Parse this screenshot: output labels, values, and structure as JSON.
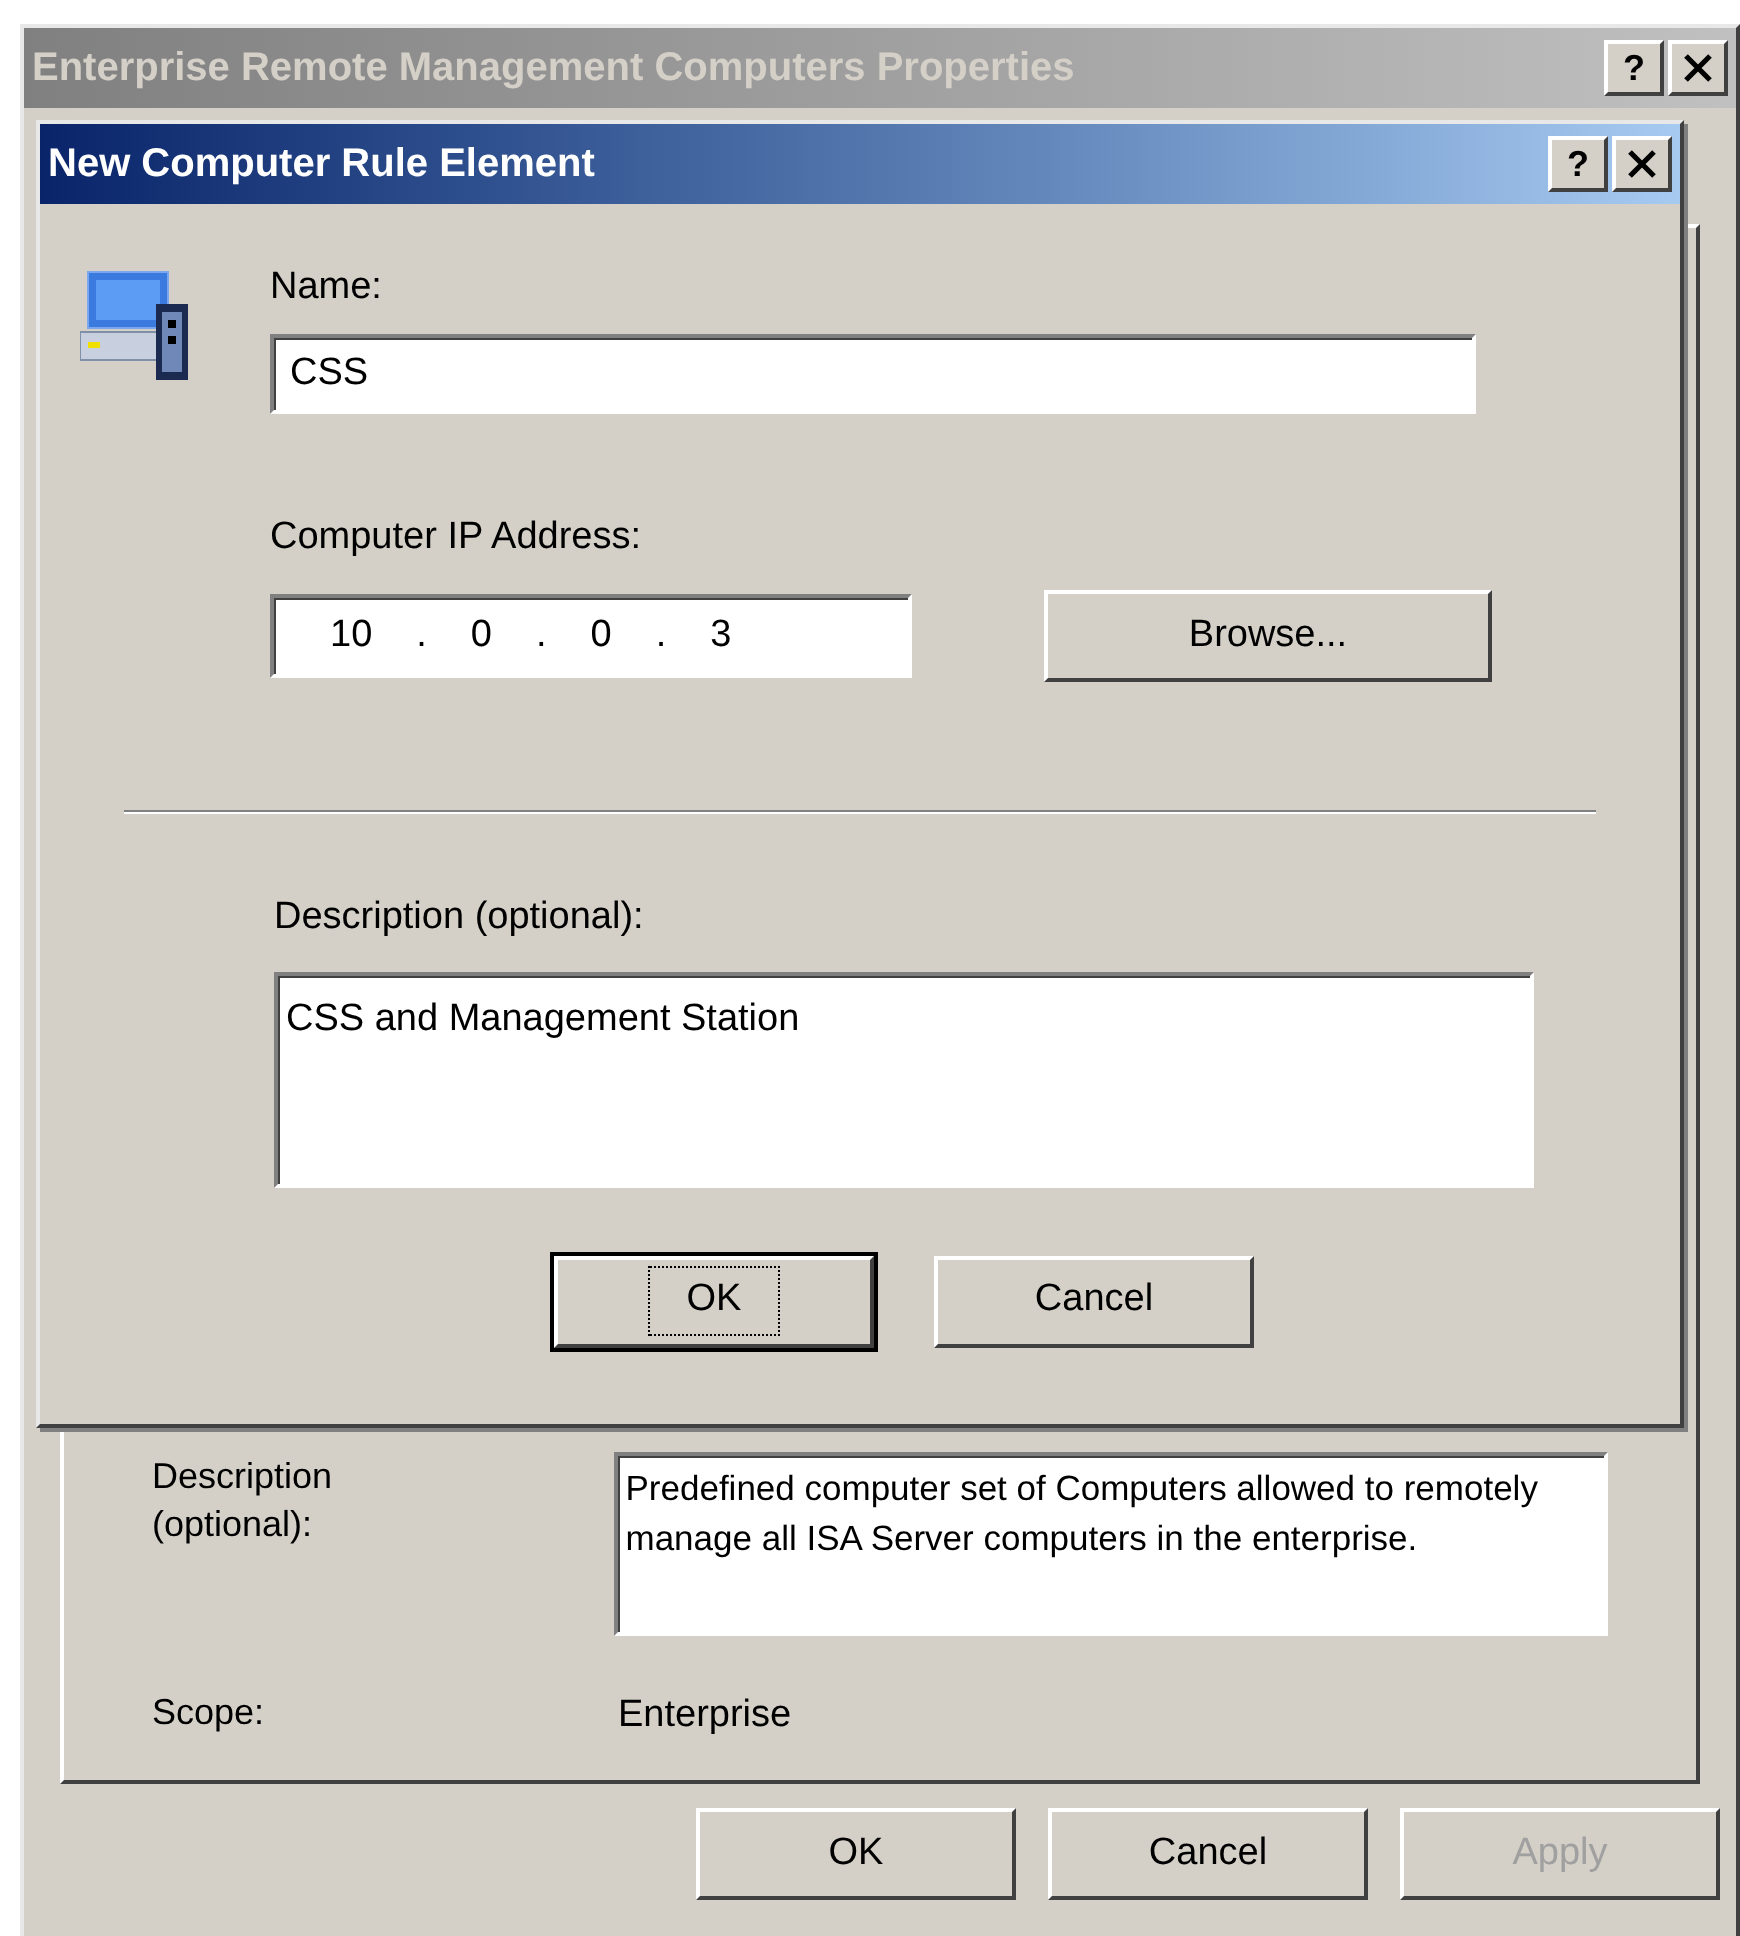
{
  "properties_window": {
    "title": "Enterprise Remote Management Computers Properties",
    "active": false,
    "help": "?",
    "fields": [
      {
        "kind": "textbox",
        "label": "Description\n(optional):",
        "value": "Predefined computer set of Computers allowed to remotely manage all ISA Server computers in the enterprise."
      },
      {
        "kind": "text",
        "label": "Scope:",
        "value": "Enterprise"
      }
    ],
    "buttons": [
      {
        "label": "OK",
        "default": false,
        "disabled": false
      },
      {
        "label": "Cancel",
        "default": false,
        "disabled": false
      },
      {
        "label": "Apply",
        "default": false,
        "disabled": true
      }
    ]
  },
  "rule_dialog": {
    "title": "New Computer Rule Element",
    "active": true,
    "help": "?",
    "name": {
      "label": "Name:",
      "value": "CSS"
    },
    "ip": {
      "label": "Computer IP Address:",
      "octets": [
        "10",
        "0",
        "0",
        "3"
      ],
      "separator": "."
    },
    "browse_button": {
      "label": "Browse...",
      "default": false,
      "disabled": false
    },
    "description": {
      "label": "Description (optional):",
      "value": "CSS and Management Station"
    },
    "buttons": [
      {
        "label": "OK",
        "default": true,
        "disabled": false
      },
      {
        "label": "Cancel",
        "default": false,
        "disabled": false
      }
    ]
  }
}
